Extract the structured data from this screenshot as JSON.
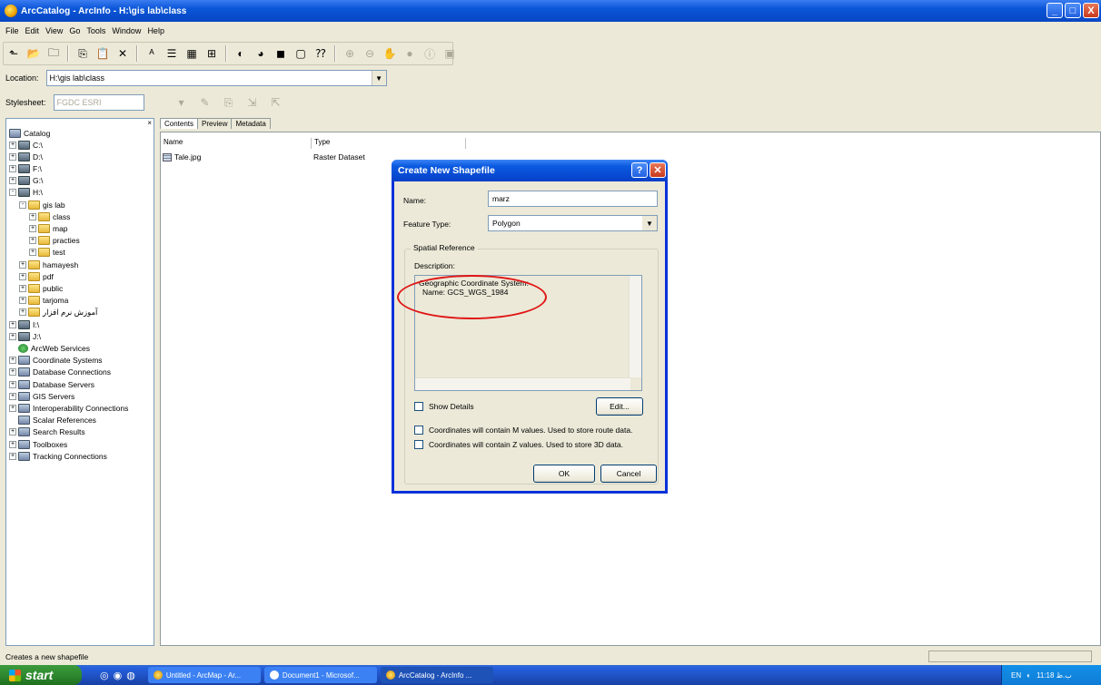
{
  "window": {
    "title": "ArcCatalog - ArcInfo - H:\\gis lab\\class",
    "controls": [
      "_",
      "□",
      "X"
    ]
  },
  "menubar": [
    "File",
    "Edit",
    "View",
    "Go",
    "Tools",
    "Window",
    "Help"
  ],
  "location": {
    "label": "Location:",
    "value": "H:\\gis lab\\class"
  },
  "stylesheet": {
    "label": "Stylesheet:",
    "value": "FGDC ESRI"
  },
  "tree": {
    "root": "Catalog",
    "items": [
      {
        "label": "C:\\",
        "type": "drive",
        "depth": 0,
        "toggle": "+"
      },
      {
        "label": "D:\\",
        "type": "drive",
        "depth": 0,
        "toggle": "+"
      },
      {
        "label": "F:\\",
        "type": "drive",
        "depth": 0,
        "toggle": "+"
      },
      {
        "label": "G:\\",
        "type": "drive",
        "depth": 0,
        "toggle": "+"
      },
      {
        "label": "H:\\",
        "type": "drive",
        "depth": 0,
        "toggle": "-"
      },
      {
        "label": "gis lab",
        "type": "folder",
        "depth": 1,
        "toggle": "-"
      },
      {
        "label": "class",
        "type": "folder",
        "depth": 2,
        "toggle": "+"
      },
      {
        "label": "map",
        "type": "folder",
        "depth": 2,
        "toggle": "+"
      },
      {
        "label": "practies",
        "type": "folder",
        "depth": 2,
        "toggle": "+"
      },
      {
        "label": "test",
        "type": "folder",
        "depth": 2,
        "toggle": "+"
      },
      {
        "label": "hamayesh",
        "type": "folder",
        "depth": 1,
        "toggle": "+"
      },
      {
        "label": "pdf",
        "type": "folder",
        "depth": 1,
        "toggle": "+"
      },
      {
        "label": "public",
        "type": "folder",
        "depth": 1,
        "toggle": "+"
      },
      {
        "label": "tarjoma",
        "type": "folder",
        "depth": 1,
        "toggle": "+"
      },
      {
        "label": "آموزش نرم افزار",
        "type": "folder",
        "depth": 1,
        "toggle": "+"
      },
      {
        "label": "I:\\",
        "type": "drive",
        "depth": 0,
        "toggle": "+"
      },
      {
        "label": "J:\\",
        "type": "drive",
        "depth": 0,
        "toggle": "+"
      },
      {
        "label": "ArcWeb Services",
        "type": "globe",
        "depth": 0,
        "toggle": ""
      },
      {
        "label": "Coordinate Systems",
        "type": "misc",
        "depth": 0,
        "toggle": "+"
      },
      {
        "label": "Database Connections",
        "type": "misc",
        "depth": 0,
        "toggle": "+"
      },
      {
        "label": "Database Servers",
        "type": "misc",
        "depth": 0,
        "toggle": "+"
      },
      {
        "label": "GIS Servers",
        "type": "misc",
        "depth": 0,
        "toggle": "+"
      },
      {
        "label": "Interoperability Connections",
        "type": "misc",
        "depth": 0,
        "toggle": "+"
      },
      {
        "label": "Scalar References",
        "type": "misc",
        "depth": 0,
        "toggle": ""
      },
      {
        "label": "Search Results",
        "type": "misc",
        "depth": 0,
        "toggle": "+"
      },
      {
        "label": "Toolboxes",
        "type": "misc",
        "depth": 0,
        "toggle": "+"
      },
      {
        "label": "Tracking Connections",
        "type": "misc",
        "depth": 0,
        "toggle": "+"
      }
    ]
  },
  "tabs": [
    "Contents",
    "Preview",
    "Metadata"
  ],
  "contents": {
    "columns": [
      "Name",
      "Type"
    ],
    "rows": [
      {
        "name": "Tale.jpg",
        "type": "Raster Dataset"
      }
    ]
  },
  "dialog": {
    "title": "Create New Shapefile",
    "name_label": "Name:",
    "name_value": "marz",
    "feature_type_label": "Feature Type:",
    "feature_type_value": "Polygon",
    "spatial_reference_label": "Spatial Reference",
    "description_label": "Description:",
    "description_line1": "Geographic Coordinate System:",
    "description_line2": "Name: GCS_WGS_1984",
    "show_details_label": "Show Details",
    "edit_button": "Edit...",
    "m_values_label": "Coordinates will contain M values. Used to store route data.",
    "z_values_label": "Coordinates will contain Z values. Used to store 3D data.",
    "ok_button": "OK",
    "cancel_button": "Cancel"
  },
  "status": "Creates a new shapefile",
  "taskbar": {
    "start": "start",
    "tasks": [
      "Untitled - ArcMap - Ar...",
      "Document1 - Microsof...",
      "ArcCatalog - ArcInfo ..."
    ],
    "tray_lang": "EN",
    "tray_time": "11:18 ب.ظ"
  }
}
